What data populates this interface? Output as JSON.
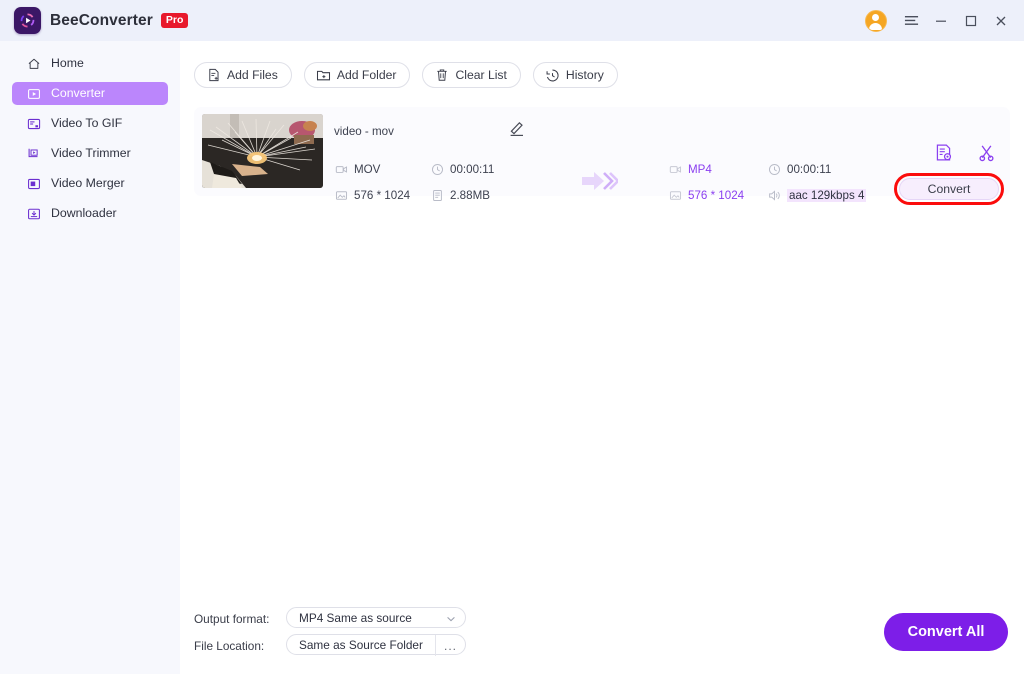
{
  "app": {
    "brand_name": "BeeConverter",
    "pro_badge": "Pro",
    "logo_icon": "bee-converter-logo-icon"
  },
  "titlebar": {
    "avatar_icon": "user-avatar-icon",
    "menu_icon": "hamburger-menu-icon",
    "minimize_icon": "minimize-icon",
    "maximize_icon": "maximize-icon",
    "close_icon": "close-icon"
  },
  "sidebar": {
    "items": [
      {
        "label": "Home",
        "icon": "home-icon",
        "active": false
      },
      {
        "label": "Converter",
        "icon": "converter-play-icon",
        "active": true
      },
      {
        "label": "Video To GIF",
        "icon": "video-to-gif-icon",
        "active": false
      },
      {
        "label": "Video Trimmer",
        "icon": "video-trimmer-icon",
        "active": false
      },
      {
        "label": "Video Merger",
        "icon": "video-merger-icon",
        "active": false
      },
      {
        "label": "Downloader",
        "icon": "download-icon",
        "active": false
      }
    ]
  },
  "toolbar": {
    "add_files_label": "Add Files",
    "add_files_icon": "add-file-icon",
    "add_folder_label": "Add Folder",
    "add_folder_icon": "add-folder-icon",
    "clear_list_label": "Clear List",
    "clear_list_icon": "trash-icon",
    "history_label": "History",
    "history_icon": "history-clock-icon"
  },
  "file_row": {
    "thumbnail_icon": "video-thumbnail-preview",
    "file_name": "video - mov",
    "edit_icon": "pencil-edit-icon",
    "source": {
      "format": "MOV",
      "format_icon": "video-format-icon",
      "duration": "00:00:11",
      "duration_icon": "clock-icon",
      "resolution": "576 * 1024",
      "resolution_icon": "resolution-icon",
      "filesize": "2.88MB",
      "filesize_icon": "file-size-icon"
    },
    "arrow_icon": "convert-arrow-icon",
    "target": {
      "format": "MP4",
      "format_icon": "video-format-icon",
      "duration": "00:00:11",
      "duration_icon": "clock-icon",
      "resolution": "576 * 1024",
      "resolution_icon": "resolution-icon",
      "audio": "aac 129kbps 4",
      "audio_icon": "speaker-icon"
    },
    "settings_icon": "output-settings-icon",
    "cut_icon": "scissors-trim-icon",
    "convert_label": "Convert",
    "highlight_color": "#fb0c0c"
  },
  "annotation": {
    "arrow_icon": "red-pointer-arrow",
    "color": "#fb0c0c"
  },
  "footer": {
    "output_format_label": "Output format:",
    "output_format_value": "MP4 Same as source",
    "output_format_caret_icon": "chevron-down-icon",
    "file_location_label": "File Location:",
    "file_location_value": "Same as Source Folder",
    "file_location_browse_icon": "ellipsis-browse-icon",
    "file_location_browse_label": "...",
    "convert_all_label": "Convert All",
    "convert_all_color": "#7d1ee8"
  },
  "theme": {
    "titlebar_bg": "#edf0fa",
    "sidebar_bg": "#f7f8fd",
    "main_bg": "#ffffff",
    "card_bg": "#fbfbfe",
    "accent": "#8b3ff0",
    "active_item_bg": "#bb86fc",
    "badge_red": "#e8192c",
    "avatar_orange": "#f5a623"
  }
}
